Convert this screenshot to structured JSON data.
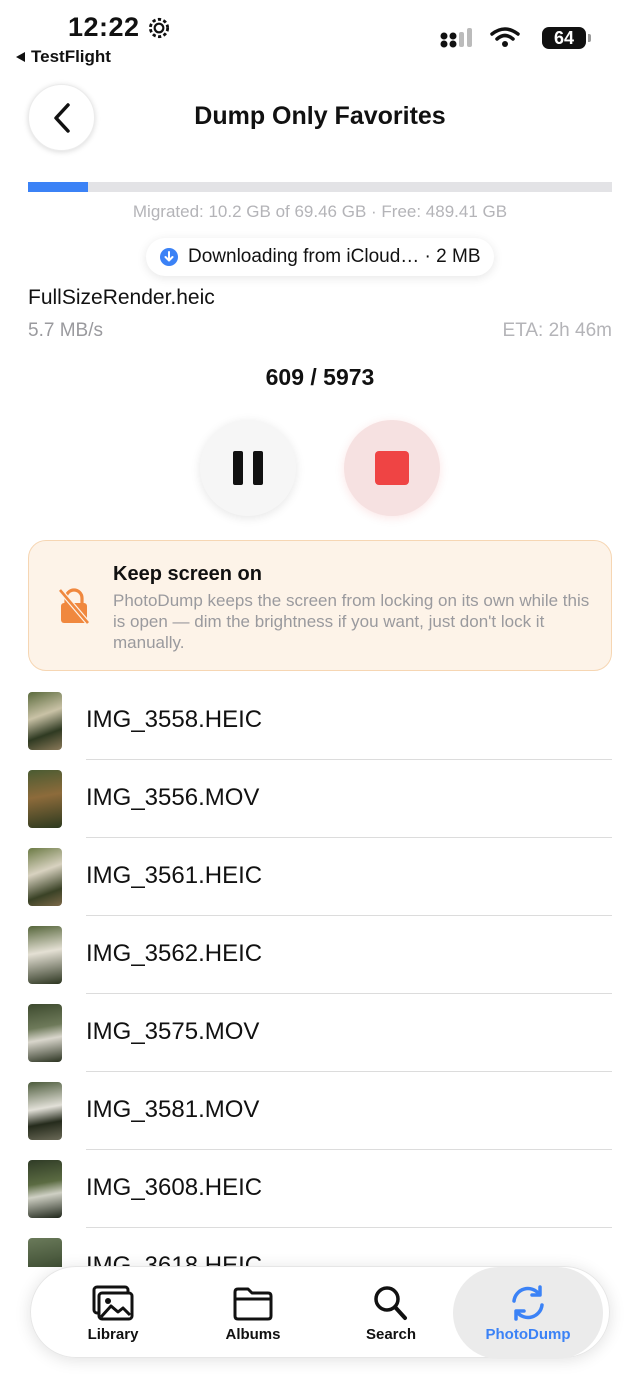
{
  "status_bar": {
    "time": "12:22",
    "back_app": "TestFlight",
    "battery": "64"
  },
  "nav": {
    "title": "Dump Only Favorites"
  },
  "progress": {
    "fraction": 0.103,
    "migrated_text": "Migrated: 10.2 GB of 69.46 GB · Free: 489.41 GB"
  },
  "download": {
    "text": "Downloading from iCloud… · 2 MB"
  },
  "current_file": {
    "name": "FullSizeRender.heic",
    "speed": "5.7 MB/s",
    "eta": "ETA: 2h 46m"
  },
  "counter": "609 / 5973",
  "banner": {
    "title": "Keep screen on",
    "body": "PhotoDump keeps the screen from locking on its own while this is open — dim the brightness if you want, just don't lock it manually."
  },
  "files": [
    {
      "name": "IMG_3558.HEIC"
    },
    {
      "name": "IMG_3556.MOV"
    },
    {
      "name": "IMG_3561.HEIC"
    },
    {
      "name": "IMG_3562.HEIC"
    },
    {
      "name": "IMG_3575.MOV"
    },
    {
      "name": "IMG_3581.MOV"
    },
    {
      "name": "IMG_3608.HEIC"
    },
    {
      "name": "IMG_3618.HEIC"
    }
  ],
  "tabs": [
    {
      "label": "Library",
      "icon": "photo-library-icon"
    },
    {
      "label": "Albums",
      "icon": "folder-icon"
    },
    {
      "label": "Search",
      "icon": "search-icon"
    },
    {
      "label": "PhotoDump",
      "icon": "sync-icon"
    }
  ],
  "colors": {
    "accent": "#3b82f6",
    "stop": "#ef4444",
    "banner_bg": "#fdf3e8",
    "banner_icon": "#f0883e"
  }
}
